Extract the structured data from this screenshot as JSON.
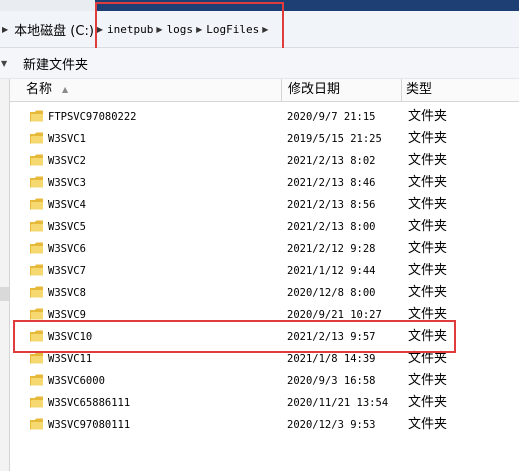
{
  "window": {
    "accent_color": "#1d3f73"
  },
  "address_bar": {
    "root_label": "本地磁盘 (C:)",
    "segments": [
      "inetpub",
      "logs",
      "LogFiles"
    ],
    "highlight_color": "#e13c3c"
  },
  "toolbar": {
    "new_folder_label": "新建文件夹"
  },
  "columns": {
    "name": "名称",
    "modified": "修改日期",
    "type": "类型"
  },
  "files": [
    {
      "name": "FTPSVC97080222",
      "modified": "2020/9/7 21:15",
      "type": "文件夹"
    },
    {
      "name": "W3SVC1",
      "modified": "2019/5/15 21:25",
      "type": "文件夹"
    },
    {
      "name": "W3SVC2",
      "modified": "2021/2/13 8:02",
      "type": "文件夹"
    },
    {
      "name": "W3SVC3",
      "modified": "2021/2/13 8:46",
      "type": "文件夹"
    },
    {
      "name": "W3SVC4",
      "modified": "2021/2/13 8:56",
      "type": "文件夹"
    },
    {
      "name": "W3SVC5",
      "modified": "2021/2/13 8:00",
      "type": "文件夹"
    },
    {
      "name": "W3SVC6",
      "modified": "2021/2/12 9:28",
      "type": "文件夹"
    },
    {
      "name": "W3SVC7",
      "modified": "2021/1/12 9:44",
      "type": "文件夹"
    },
    {
      "name": "W3SVC8",
      "modified": "2020/12/8 8:00",
      "type": "文件夹"
    },
    {
      "name": "W3SVC9",
      "modified": "2020/9/21 10:27",
      "type": "文件夹"
    },
    {
      "name": "W3SVC10",
      "modified": "2021/2/13 9:57",
      "type": "文件夹",
      "highlighted": true
    },
    {
      "name": "W3SVC11",
      "modified": "2021/1/8 14:39",
      "type": "文件夹"
    },
    {
      "name": "W3SVC6000",
      "modified": "2020/9/3 16:58",
      "type": "文件夹"
    },
    {
      "name": "W3SVC65886111",
      "modified": "2020/11/21 13:54",
      "type": "文件夹"
    },
    {
      "name": "W3SVC97080111",
      "modified": "2020/12/3 9:53",
      "type": "文件夹"
    }
  ]
}
